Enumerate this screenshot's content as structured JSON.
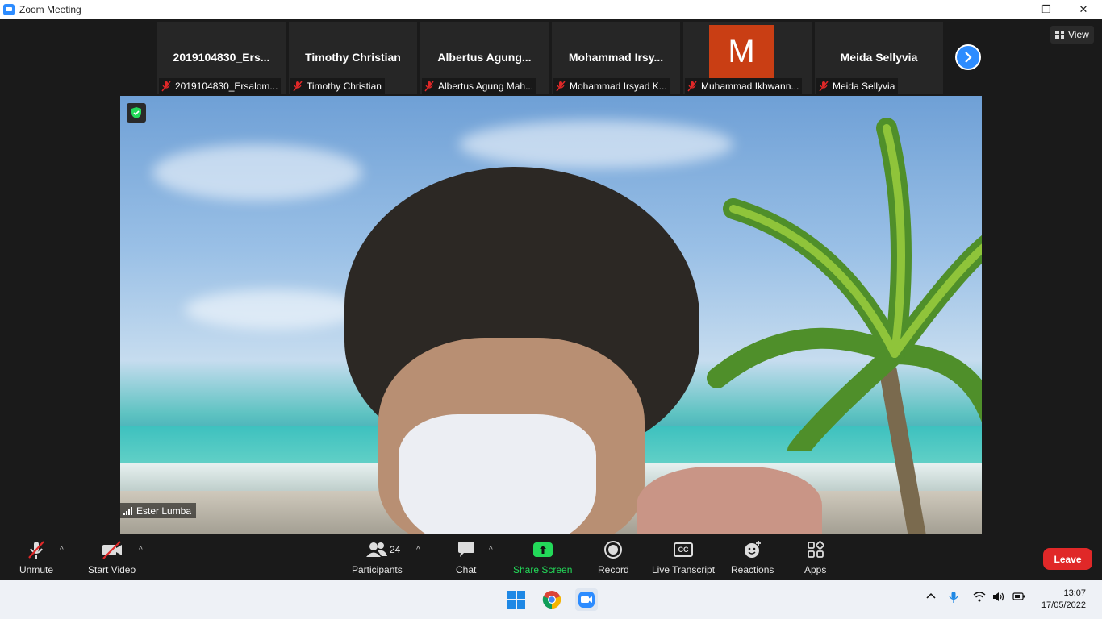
{
  "window": {
    "title": "Zoom Meeting",
    "controls": {
      "minimize": "—",
      "restore": "❐",
      "close": "✕"
    }
  },
  "gallery": {
    "tiles": [
      {
        "display_name": "2019104830_Ers...",
        "label": "2019104830_Ersalom...",
        "avatar": ""
      },
      {
        "display_name": "Timothy Christian",
        "label": "Timothy Christian",
        "avatar": ""
      },
      {
        "display_name": "Albertus  Agung...",
        "label": "Albertus Agung Mah...",
        "avatar": ""
      },
      {
        "display_name": "Mohammad  Irsy...",
        "label": "Mohammad Irsyad K...",
        "avatar": ""
      },
      {
        "display_name": "",
        "label": "Muhammad Ikhwann...",
        "avatar": "M"
      },
      {
        "display_name": "Meida Sellyvia",
        "label": "Meida Sellyvia",
        "avatar": ""
      }
    ],
    "next_icon": "chevron-right-icon"
  },
  "view_button": {
    "label": "View"
  },
  "main_speaker": {
    "name": "Ester Lumba"
  },
  "toolbar": {
    "unmute": "Unmute",
    "start_video": "Start Video",
    "participants": "Participants",
    "participant_count": "24",
    "chat": "Chat",
    "share_screen": "Share Screen",
    "record": "Record",
    "live_transcript": "Live Transcript",
    "cc": "CC",
    "reactions": "Reactions",
    "apps": "Apps",
    "leave": "Leave"
  },
  "taskbar": {
    "time": "13:07",
    "date": "17/05/2022"
  },
  "colors": {
    "accent": "#2d8cff",
    "share_green": "#23d959",
    "leave_red": "#e02828",
    "avatar_orange": "#c93e14"
  }
}
